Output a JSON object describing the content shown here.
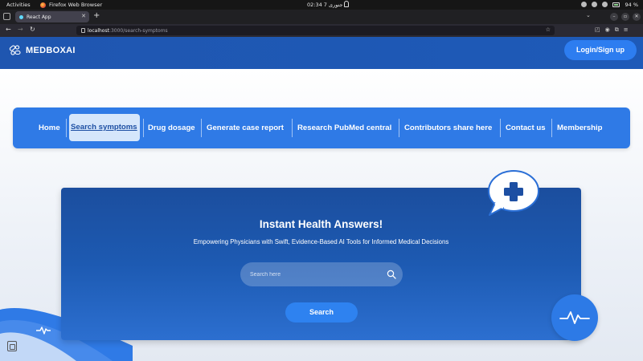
{
  "system_bar": {
    "activities": "Activities",
    "app_name": "Firefox Web Browser",
    "clock": "02:34  7 جنوری",
    "battery": "94 %"
  },
  "browser": {
    "tab_title": "React App",
    "url_host": "localhost",
    "url_path": ":3000/search-symptoms"
  },
  "header": {
    "brand": "MEDBOXAI",
    "login_label": "Login/Sign up"
  },
  "nav": {
    "items": [
      {
        "label": "Home"
      },
      {
        "label": "Search symptoms"
      },
      {
        "label": "Drug dosage"
      },
      {
        "label": "Generate case report"
      },
      {
        "label": "Research PubMed central"
      },
      {
        "label": "Contributors share here"
      },
      {
        "label": "Contact us"
      },
      {
        "label": "Membership"
      }
    ],
    "active_index": 1
  },
  "hero": {
    "title": "Instant Health Answers!",
    "subtitle": "Empowering Physicians with Swift, Evidence-Based AI Tools for Informed Medical Decisions",
    "search_placeholder": "Search here",
    "search_button": "Search"
  },
  "colors": {
    "header_bg": "#1f56b0",
    "nav_card": "#2f7ae6",
    "hero_bg": "#1d5ab2",
    "button": "#2e82f0"
  },
  "icons": [
    "logo-icon",
    "plus-icon",
    "search-icon",
    "heartbeat-icon",
    "clipboard-icon"
  ]
}
